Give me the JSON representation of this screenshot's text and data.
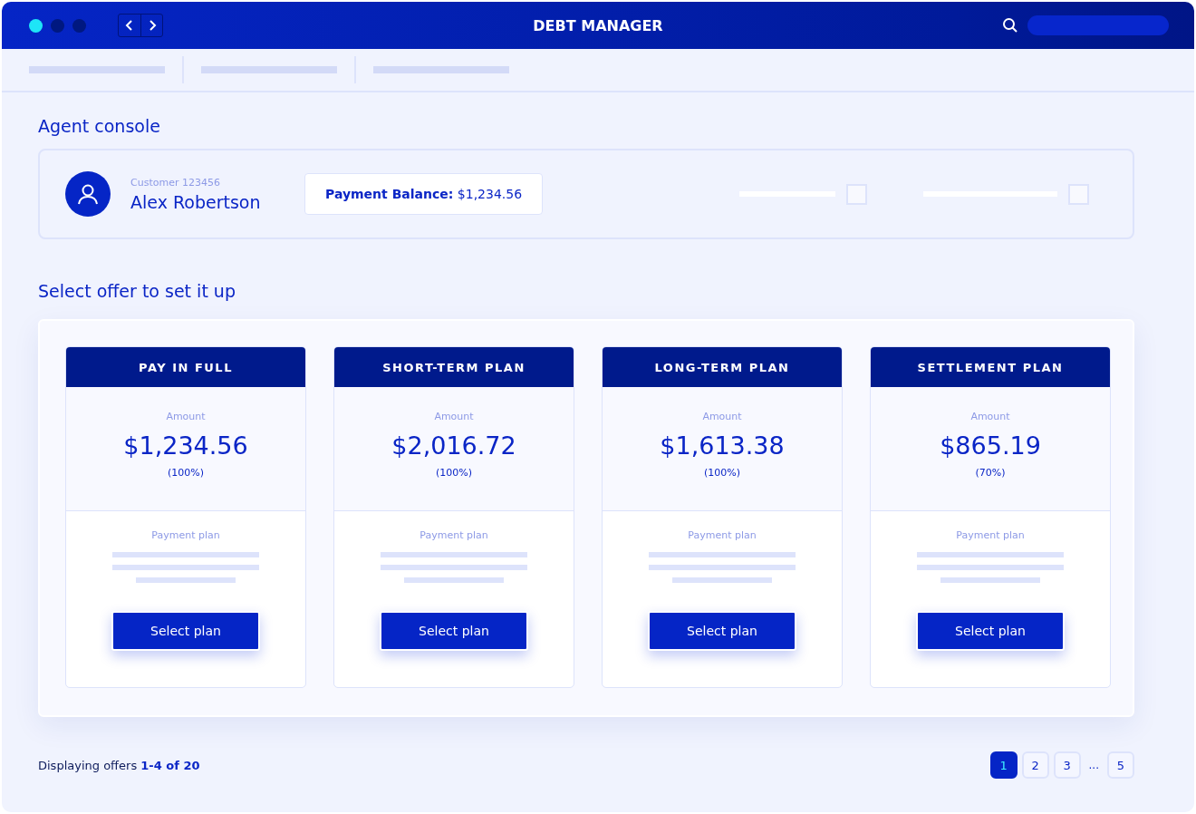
{
  "window": {
    "title": "DEBT MANAGER"
  },
  "page_title": "Agent console",
  "customer": {
    "id_label": "Customer 123456",
    "name": "Alex Robertson",
    "balance_label": "Payment Balance:",
    "balance_value": "$1,234.56",
    "options": [
      {
        "checked": false
      },
      {
        "checked": false
      }
    ]
  },
  "offers_title": "Select offer to set it up",
  "offers": [
    {
      "title": "PAY IN FULL",
      "amount_label": "Amount",
      "amount": "$1,234.56",
      "percent": "(100%)",
      "plan_label": "Payment plan",
      "button": "Select plan"
    },
    {
      "title": "SHORT-TERM PLAN",
      "amount_label": "Amount",
      "amount": "$2,016.72",
      "percent": "(100%)",
      "plan_label": "Payment plan",
      "button": "Select plan"
    },
    {
      "title": "LONG-TERM PLAN",
      "amount_label": "Amount",
      "amount": "$1,613.38",
      "percent": "(100%)",
      "plan_label": "Payment plan",
      "button": "Select plan"
    },
    {
      "title": "SETTLEMENT PLAN",
      "amount_label": "Amount",
      "amount": "$865.19",
      "percent": "(70%)",
      "plan_label": "Payment plan",
      "button": "Select plan"
    }
  ],
  "footer": {
    "prefix": "Displaying offers",
    "range": "1-4 of 20"
  },
  "pagination": [
    {
      "kind": "page",
      "label": "1",
      "selected": true
    },
    {
      "kind": "page",
      "label": "2",
      "selected": false
    },
    {
      "kind": "page",
      "label": "3",
      "selected": false
    },
    {
      "kind": "ellipsis",
      "label": "..."
    },
    {
      "kind": "page",
      "label": "5",
      "selected": false
    }
  ]
}
